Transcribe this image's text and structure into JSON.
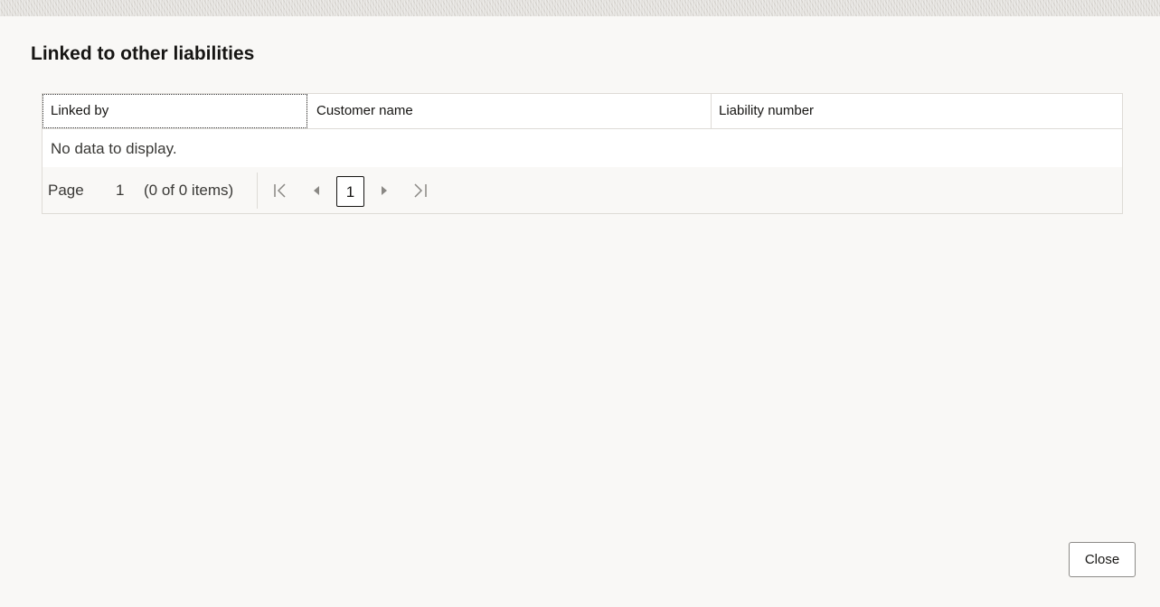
{
  "dialog": {
    "title": "Linked to other liabilities"
  },
  "table": {
    "columns": [
      "Linked by",
      "Customer name",
      "Liability number"
    ],
    "rows": [],
    "empty_message": "No data to display."
  },
  "pagination": {
    "page_label": "Page",
    "current_page": "1",
    "items_summary": "(0 of 0 items)",
    "page_button": "1",
    "icons": {
      "first": "first-page-icon",
      "previous": "previous-page-icon",
      "next": "next-page-icon",
      "last": "last-page-icon"
    }
  },
  "footer": {
    "close_label": "Close"
  },
  "colors": {
    "background": "#f9f8f6",
    "border": "#dedbd6",
    "text": "#161513",
    "icon_muted": "#8a8884"
  }
}
